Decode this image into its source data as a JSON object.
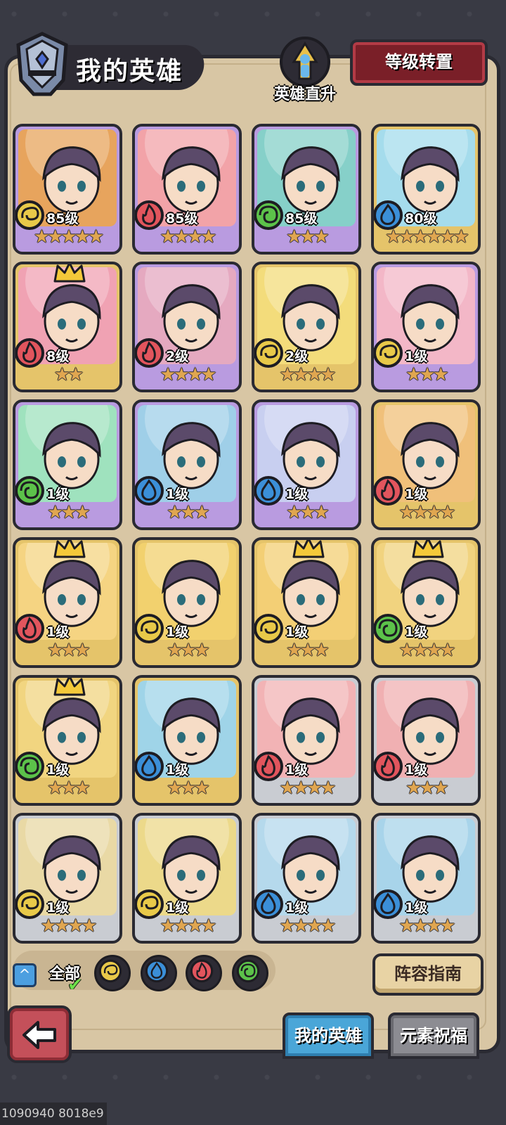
{
  "header": {
    "title": "我的英雄",
    "levelup_label": "英雄直升",
    "transfer_button": "等级转置"
  },
  "heroes": [
    {
      "level": "85级",
      "element": "earth",
      "rarity": "purple",
      "stars": 5,
      "crown": false,
      "bg": "#e7a45d"
    },
    {
      "level": "85级",
      "element": "fire",
      "rarity": "purple",
      "stars": 4,
      "crown": false,
      "bg": "#f2a3a8"
    },
    {
      "level": "85级",
      "element": "wind",
      "rarity": "purple",
      "stars": 3,
      "crown": false,
      "bg": "#86d0c9"
    },
    {
      "level": "80级",
      "element": "water",
      "rarity": "gold",
      "stars": 6,
      "crown": false,
      "bg": "#a5dcec"
    },
    {
      "level": "8级",
      "element": "fire",
      "rarity": "gold",
      "stars": 2,
      "crown": true,
      "bg": "#f0a2b3"
    },
    {
      "level": "2级",
      "element": "fire",
      "rarity": "purple",
      "stars": 4,
      "crown": false,
      "bg": "#e5a9c0"
    },
    {
      "level": "2级",
      "element": "earth",
      "rarity": "gold",
      "stars": 4,
      "crown": false,
      "bg": "#f3dc7b"
    },
    {
      "level": "1级",
      "element": "earth",
      "rarity": "purple",
      "stars": 3,
      "crown": false,
      "bg": "#f3b7c7"
    },
    {
      "level": "1级",
      "element": "wind",
      "rarity": "purple",
      "stars": 3,
      "crown": false,
      "bg": "#9fe2be"
    },
    {
      "level": "1级",
      "element": "water",
      "rarity": "purple",
      "stars": 3,
      "crown": false,
      "bg": "#9fcfe8"
    },
    {
      "level": "1级",
      "element": "water",
      "rarity": "purple",
      "stars": 3,
      "crown": false,
      "bg": "#c8cff0"
    },
    {
      "level": "1级",
      "element": "fire",
      "rarity": "gold",
      "stars": 4,
      "crown": false,
      "bg": "#f0c07a"
    },
    {
      "level": "1级",
      "element": "fire",
      "rarity": "gold",
      "stars": 3,
      "crown": true,
      "bg": "#f5d482"
    },
    {
      "level": "1级",
      "element": "earth",
      "rarity": "gold",
      "stars": 3,
      "crown": false,
      "bg": "#f2d16e"
    },
    {
      "level": "1级",
      "element": "earth",
      "rarity": "gold",
      "stars": 3,
      "crown": true,
      "bg": "#f3cf75"
    },
    {
      "level": "1级",
      "element": "wind",
      "rarity": "gold",
      "stars": 4,
      "crown": true,
      "bg": "#f1d37f"
    },
    {
      "level": "1级",
      "element": "wind",
      "rarity": "gold",
      "stars": 3,
      "crown": true,
      "bg": "#f1d580"
    },
    {
      "level": "1级",
      "element": "water",
      "rarity": "gold",
      "stars": 3,
      "crown": false,
      "bg": "#9fd4e8"
    },
    {
      "level": "1级",
      "element": "fire",
      "rarity": "silver",
      "stars": 4,
      "crown": false,
      "bg": "#f2b3b5"
    },
    {
      "level": "1级",
      "element": "fire",
      "rarity": "silver",
      "stars": 3,
      "crown": false,
      "bg": "#f0b0b2"
    },
    {
      "level": "1级",
      "element": "earth",
      "rarity": "silver",
      "stars": 4,
      "crown": false,
      "bg": "#e9d9a5"
    },
    {
      "level": "1级",
      "element": "earth",
      "rarity": "silver",
      "stars": 4,
      "crown": false,
      "bg": "#ecd98a"
    },
    {
      "level": "1级",
      "element": "water",
      "rarity": "silver",
      "stars": 4,
      "crown": false,
      "bg": "#b5d9ec"
    },
    {
      "level": "1级",
      "element": "water",
      "rarity": "silver",
      "stars": 4,
      "crown": false,
      "bg": "#a8d4ea"
    }
  ],
  "filters": {
    "all_label": "全部",
    "elements": [
      "earth",
      "water",
      "fire",
      "wind"
    ]
  },
  "guide_button": "阵容指南",
  "tabs": [
    {
      "label": "我的英雄",
      "active": true
    },
    {
      "label": "元素祝福",
      "active": false
    }
  ],
  "footer_id": "1090940 8018e9",
  "colors": {
    "earth": "#e8c949",
    "water": "#3b8fd8",
    "fire": "#e2555d",
    "wind": "#5cc24a"
  }
}
